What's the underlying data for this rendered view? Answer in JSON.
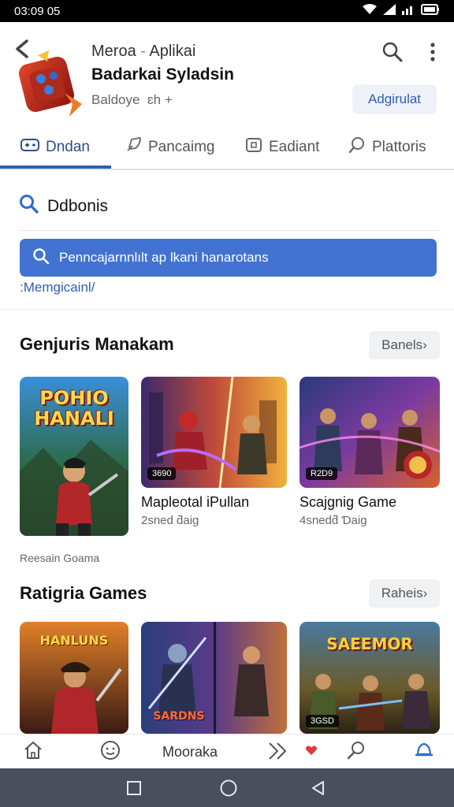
{
  "status_bar": {
    "time": "03:09 05"
  },
  "header": {
    "subtitle_left": "Meroa",
    "subtitle_sep": "-",
    "subtitle_right": "Aplikai",
    "title": "Badarkai Syladsin",
    "meta": "Baldoye  ɛh +",
    "install_label": "Adgirulat"
  },
  "tabs": [
    {
      "label": "Dndan",
      "icon": "gamepad-icon",
      "active": true
    },
    {
      "label": "Pancaimg",
      "icon": "rocket-icon",
      "active": false
    },
    {
      "label": "Eadiant",
      "icon": "app-box-icon",
      "active": false
    },
    {
      "label": "Plattoris",
      "icon": "search-icon",
      "active": false
    }
  ],
  "search": {
    "heading": "Ddbonis",
    "placeholder": "Penncajarnnlılt ap lkani hanarotans",
    "hint": ":Memgicainl/"
  },
  "section1": {
    "title": "Genjuris Manakam",
    "see_more": "Banels",
    "items": [
      {
        "name": "",
        "size": "",
        "art_title": "POHIO HANALI",
        "badge": ""
      },
      {
        "name": "Mapleotal iPullan",
        "size": "2sned ƌaig",
        "badge": "3690"
      },
      {
        "name": "Scajgnig Game",
        "size": "4snedƌ Ɗaig",
        "badge": "R2D9"
      }
    ],
    "caption": "Reesain Goama"
  },
  "section2": {
    "title": "Ratigria Games",
    "see_more": "Raheis",
    "items": [
      {
        "art_title": "HANLUNS",
        "badge": ""
      },
      {
        "art_title": "SARDNS",
        "badge": ""
      },
      {
        "art_title": "SAEEMOR",
        "badge": "3GSD"
      }
    ]
  },
  "bottom_nav": {
    "center_label": "Mooraka"
  },
  "colors": {
    "accent": "#2f5fb3",
    "search_bar": "#4273d2",
    "system_nav": "#4a4f5e"
  }
}
